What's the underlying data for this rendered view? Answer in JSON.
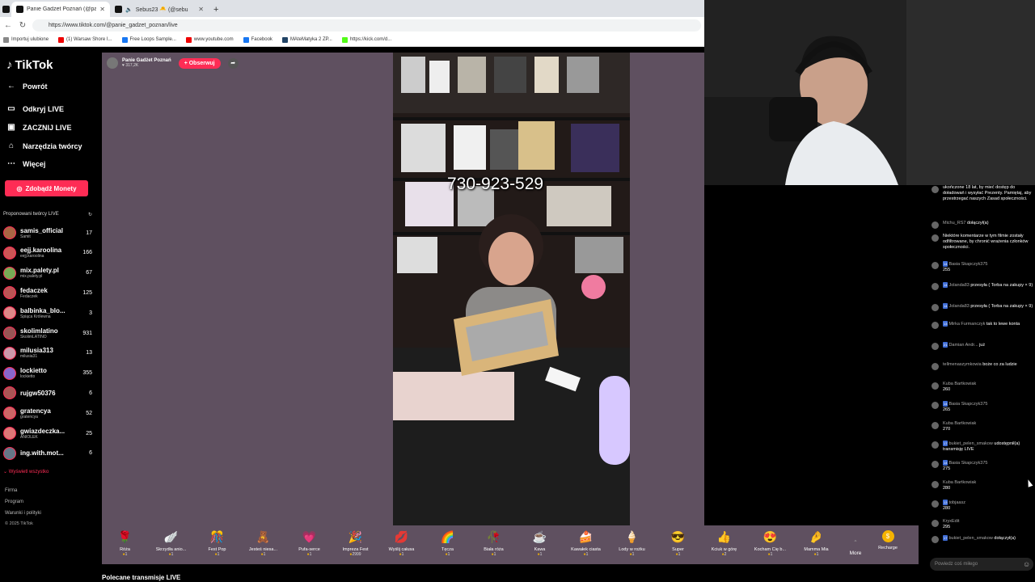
{
  "browser": {
    "tabs": [
      {
        "title": "Panie Gadżet Poznań (@panie",
        "active": true
      },
      {
        "title": "Sebus23 🐣 (@sebu",
        "active": false
      }
    ],
    "new_tab": "+",
    "url": "https://www.tiktok.com/@panie_gadzet_poznan/live",
    "bookmarks": [
      "Importuj ulubione",
      "(1) Warsaw Shore I...",
      "Free Loops Sample...",
      "www.youtube.com",
      "Facebook",
      "MAteMatyka 2 ZP...",
      "https://kick.com/d..."
    ]
  },
  "sidebar": {
    "logo": "TikTok",
    "back": "Powrót",
    "nav": [
      "Odkryj LIVE",
      "ZACZNIJ LIVE",
      "Narzędzia twórcy",
      "Więcej"
    ],
    "coins_button": "Zdobądź Monety",
    "suggested_title": "Proponowani twórcy LIVE",
    "creators": [
      {
        "name": "samis_official",
        "sub": "Samit",
        "count": "17"
      },
      {
        "name": "eejj.karoolina",
        "sub": "eejj.karoolina",
        "count": "166"
      },
      {
        "name": "mix.palety.pl",
        "sub": "mix.palety.pl",
        "count": "67"
      },
      {
        "name": "fedaczek",
        "sub": "Fedaczek",
        "count": "125"
      },
      {
        "name": "balbinka_blo...",
        "sub": "Śpiąca Królewna",
        "count": "3"
      },
      {
        "name": "skolimlatino",
        "sub": "SkolimLATINO",
        "count": "931"
      },
      {
        "name": "milusia313",
        "sub": "milusia31",
        "count": "13"
      },
      {
        "name": "lockietto",
        "sub": "lockietto",
        "count": "355"
      },
      {
        "name": "rujgw50376",
        "sub": "",
        "count": "6"
      },
      {
        "name": "gratencya",
        "sub": "gratencya",
        "count": "52"
      },
      {
        "name": "gwiazdeczka...",
        "sub": "ANIOLEK",
        "count": "25"
      },
      {
        "name": "ing.with.mot...",
        "sub": "",
        "count": "6"
      }
    ],
    "show_all": "Wyświetl wszystko",
    "footer": [
      "Firma",
      "Program",
      "Warunki i polityki",
      "© 2025 TikTok"
    ]
  },
  "stream": {
    "host_name": "Panie Gadżet Poznań",
    "viewers": "317,2K",
    "follow_button": "+ Obserwuj",
    "overlay_phone": "730-923-529"
  },
  "gifts": [
    {
      "name": "Róża",
      "icon": "🌹",
      "cost": "1"
    },
    {
      "name": "Skrzydła anio...",
      "icon": "🪽",
      "cost": "1"
    },
    {
      "name": "Fest Pop",
      "icon": "🎊",
      "cost": "1"
    },
    {
      "name": "Jesteś niesa...",
      "icon": "🧸",
      "cost": "1"
    },
    {
      "name": "Pufa-serce",
      "icon": "💗",
      "cost": "1"
    },
    {
      "name": "Impreza Fest",
      "icon": "🎉",
      "cost": "2999"
    },
    {
      "name": "Wyślij całusa",
      "icon": "💋",
      "cost": "1"
    },
    {
      "name": "Tęcza",
      "icon": "🌈",
      "cost": "1"
    },
    {
      "name": "Biała róża",
      "icon": "🥀",
      "cost": "1"
    },
    {
      "name": "Kawa",
      "icon": "☕",
      "cost": "1"
    },
    {
      "name": "Kawałek ciasta",
      "icon": "🍰",
      "cost": "1"
    },
    {
      "name": "Lody w rożku",
      "icon": "🍦",
      "cost": "1"
    },
    {
      "name": "Super",
      "icon": "😎",
      "cost": "1"
    },
    {
      "name": "Kciuk w górę",
      "icon": "👍",
      "cost": "2"
    },
    {
      "name": "Kocham Cię b...",
      "icon": "😍",
      "cost": "1"
    },
    {
      "name": "Mamma Mia",
      "icon": "🤌",
      "cost": "1"
    }
  ],
  "gift_more": "More",
  "recharge": "Recharge",
  "recommended_title": "Polecane transmisje LIVE",
  "chat": {
    "messages": [
      {
        "name": "",
        "badge": "",
        "text": "ukończone 18 lat, by mieć dostęp do doładowań i wysyłać Prezenty. Pamiętaj, aby przestrzegać naszych Zasad społeczności."
      },
      {
        "name": "Michu_RS7",
        "badge": "",
        "text": "dołączył(a)"
      },
      {
        "name": "",
        "badge": "",
        "text": "Niektóre komentarze w tym filmie zostały odfiltrowane, by chronić wrażenia członków społeczności."
      },
      {
        "name": "Basia Skapczyk375",
        "badge": "14",
        "text": "255"
      },
      {
        "name": "Jolanda83",
        "badge": "14",
        "text": "przesyła ( Torba na zakupy × 9)"
      },
      {
        "name": "Jolanda83",
        "badge": "14",
        "text": "przesyła ( Torba na zakupy × 9)"
      },
      {
        "name": "Mirka Furmanczyk",
        "badge": "13",
        "text": "tak to lewe konta"
      },
      {
        "name": "Damian Andr...",
        "badge": "21",
        "text": "już"
      },
      {
        "name": "tellmenaszymkowia",
        "badge": "",
        "text": "boże co za ludzie"
      },
      {
        "name": "Kuba Bartkowiak",
        "badge": "",
        "text": "260"
      },
      {
        "name": "Basia Skapczyk375",
        "badge": "14",
        "text": "265"
      },
      {
        "name": "Kuba Bartkowiak",
        "badge": "",
        "text": "270"
      },
      {
        "name": "bukiet_pelen_smakow",
        "badge": "17",
        "text": "udostępnił(a) transmisję LIVE"
      },
      {
        "name": "Basia Skapczyk375",
        "badge": "14",
        "text": "275"
      },
      {
        "name": "Kuba Bartkowiak",
        "badge": "",
        "text": "280"
      },
      {
        "name": "tobjaasz",
        "badge": "13",
        "text": "280"
      },
      {
        "name": "KryxEdit",
        "badge": "",
        "text": "295"
      },
      {
        "name": "bukiet_pelen_smakow",
        "badge": "17",
        "text": "dołączył(a)"
      }
    ],
    "input_placeholder": "Powiedz coś miłego"
  }
}
